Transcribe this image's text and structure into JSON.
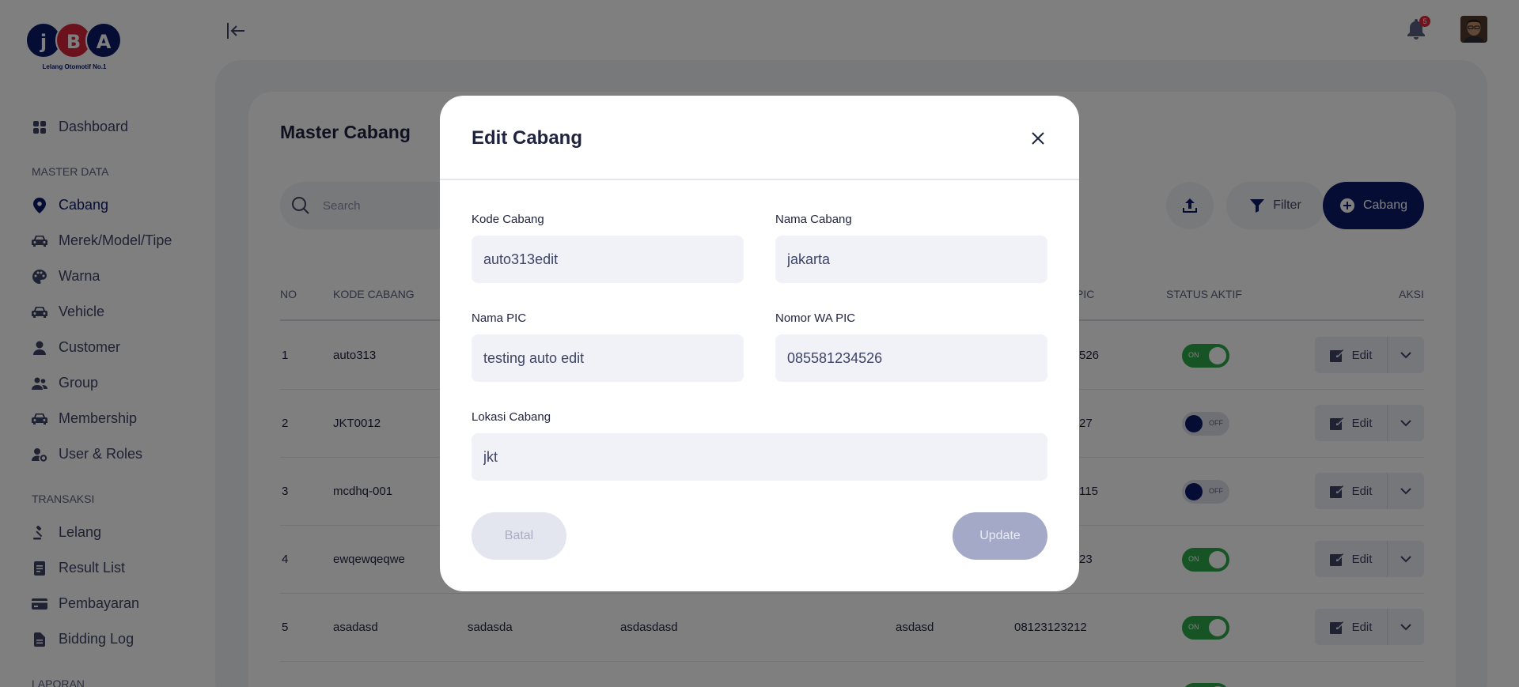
{
  "brand": {
    "logo_letters": [
      "j",
      "B",
      "A"
    ],
    "tagline": "Lelang Otomotif No.1"
  },
  "sidebar": {
    "items": [
      {
        "label": "Dashboard",
        "icon": "grid-icon"
      }
    ],
    "sections": [
      {
        "title": "MASTER DATA",
        "items": [
          {
            "label": "Cabang",
            "icon": "location-pin-icon",
            "active": true
          },
          {
            "label": "Merek/Model/Tipe",
            "icon": "car-icon"
          },
          {
            "label": "Warna",
            "icon": "palette-icon"
          },
          {
            "label": "Vehicle",
            "icon": "car-icon"
          },
          {
            "label": "Customer",
            "icon": "user-icon"
          },
          {
            "label": "Group",
            "icon": "users-icon"
          },
          {
            "label": "Membership",
            "icon": "car-icon"
          },
          {
            "label": "User & Roles",
            "icon": "user-cog-icon"
          }
        ]
      },
      {
        "title": "TRANSAKSI",
        "items": [
          {
            "label": "Lelang",
            "icon": "gavel-icon"
          },
          {
            "label": "Result List",
            "icon": "document-icon"
          },
          {
            "label": "Pembayaran",
            "icon": "credit-card-icon"
          },
          {
            "label": "Bidding Log",
            "icon": "file-icon"
          }
        ]
      },
      {
        "title": "LAPORAN",
        "items": []
      }
    ]
  },
  "header": {
    "notification_count": "5"
  },
  "page": {
    "title": "Master Cabang",
    "search_placeholder": "Search",
    "filter_label": "Filter",
    "add_label": "Cabang"
  },
  "table": {
    "columns": [
      "NO",
      "KODE CABANG",
      "PIC",
      "STATUS AKTIF",
      "AKSI"
    ],
    "rows": [
      {
        "no": "1",
        "kode": "auto313",
        "col3": "",
        "col4": "",
        "col5": "",
        "wa": "526",
        "status": "ON",
        "action": "Edit"
      },
      {
        "no": "2",
        "kode": "JKT0012",
        "col3": "",
        "col4": "",
        "col5": "",
        "wa": "27",
        "status": "OFF",
        "action": "Edit"
      },
      {
        "no": "3",
        "kode": "mcdhq-001",
        "col3": "",
        "col4": "",
        "col5": "",
        "wa": "115",
        "status": "OFF",
        "action": "Edit"
      },
      {
        "no": "4",
        "kode": "ewqewqeqwe",
        "col3": "",
        "col4": "",
        "col5": "",
        "wa": "23",
        "status": "ON",
        "action": "Edit"
      },
      {
        "no": "5",
        "kode": "asadasd",
        "col3": "sadasda",
        "col4": "asdasdasd",
        "col5": "asdasd",
        "wa": "08123123212",
        "status": "ON",
        "action": "Edit"
      }
    ]
  },
  "modal": {
    "title": "Edit Cabang",
    "fields": {
      "kode_label": "Kode Cabang",
      "kode_value": "auto313edit",
      "nama_label": "Nama Cabang",
      "nama_value": "jakarta",
      "pic_label": "Nama PIC",
      "pic_value": "testing auto edit",
      "wa_label": "Nomor WA PIC",
      "wa_value": "085581234526",
      "lokasi_label": "Lokasi Cabang",
      "lokasi_value": "jkt"
    },
    "cancel_label": "Batal",
    "submit_label": "Update"
  },
  "colors": {
    "primary": "#0b1a6b",
    "accent_red": "#d6243a",
    "toggle_on": "#2fa84a",
    "overlay": "rgba(0,0,0,0.5)"
  }
}
